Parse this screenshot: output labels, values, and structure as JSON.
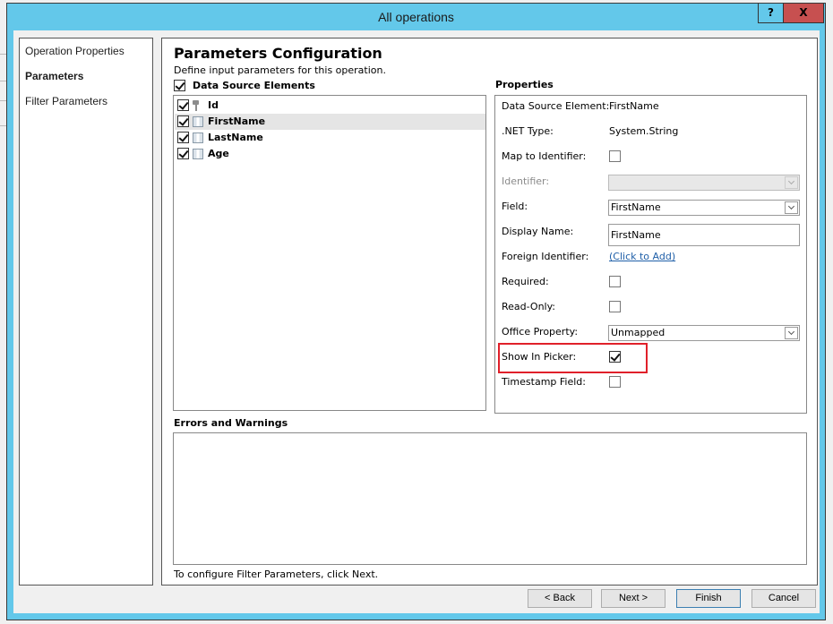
{
  "window": {
    "title": "All operations",
    "help_label": "?",
    "close_label": "X"
  },
  "nav": {
    "items": [
      {
        "label": "Operation Properties",
        "active": false
      },
      {
        "label": "Parameters",
        "active": true
      },
      {
        "label": "Filter Parameters",
        "active": false
      }
    ]
  },
  "main": {
    "heading": "Parameters Configuration",
    "subtext": "Define input parameters for this operation.",
    "data_source_header": "Data Source Elements",
    "data_source_all_checked": true,
    "elements": [
      {
        "name": "Id",
        "checked": true,
        "icon": "key-icon",
        "selected": false
      },
      {
        "name": "FirstName",
        "checked": true,
        "icon": "column-icon",
        "selected": true
      },
      {
        "name": "LastName",
        "checked": true,
        "icon": "column-icon",
        "selected": false
      },
      {
        "name": "Age",
        "checked": true,
        "icon": "column-icon",
        "selected": false
      }
    ],
    "properties_title": "Properties",
    "properties": {
      "data_source_element_label": "Data Source Element:",
      "data_source_element_value": "FirstName",
      "net_type_label": ".NET Type:",
      "net_type_value": "System.String",
      "map_to_identifier_label": "Map to Identifier:",
      "map_to_identifier_checked": false,
      "identifier_label": "Identifier:",
      "identifier_value": "",
      "field_label": "Field:",
      "field_value": "FirstName",
      "display_name_label": "Display Name:",
      "display_name_value": "FirstName",
      "foreign_identifier_label": "Foreign Identifier:",
      "foreign_identifier_link": "(Click to Add)",
      "required_label": "Required:",
      "required_checked": false,
      "read_only_label": "Read-Only:",
      "read_only_checked": false,
      "office_property_label": "Office Property:",
      "office_property_value": "Unmapped",
      "show_in_picker_label": "Show In Picker:",
      "show_in_picker_checked": true,
      "timestamp_field_label": "Timestamp Field:",
      "timestamp_field_checked": false
    },
    "errors_title": "Errors and Warnings",
    "footnote": "To configure Filter Parameters, click Next."
  },
  "buttons": {
    "back": "< Back",
    "next": "Next >",
    "finish": "Finish",
    "cancel": "Cancel"
  },
  "colors": {
    "window_frame": "#63c8ea",
    "close_button": "#c75050",
    "highlight_box": "#e0202a",
    "link": "#1f5fa8"
  }
}
